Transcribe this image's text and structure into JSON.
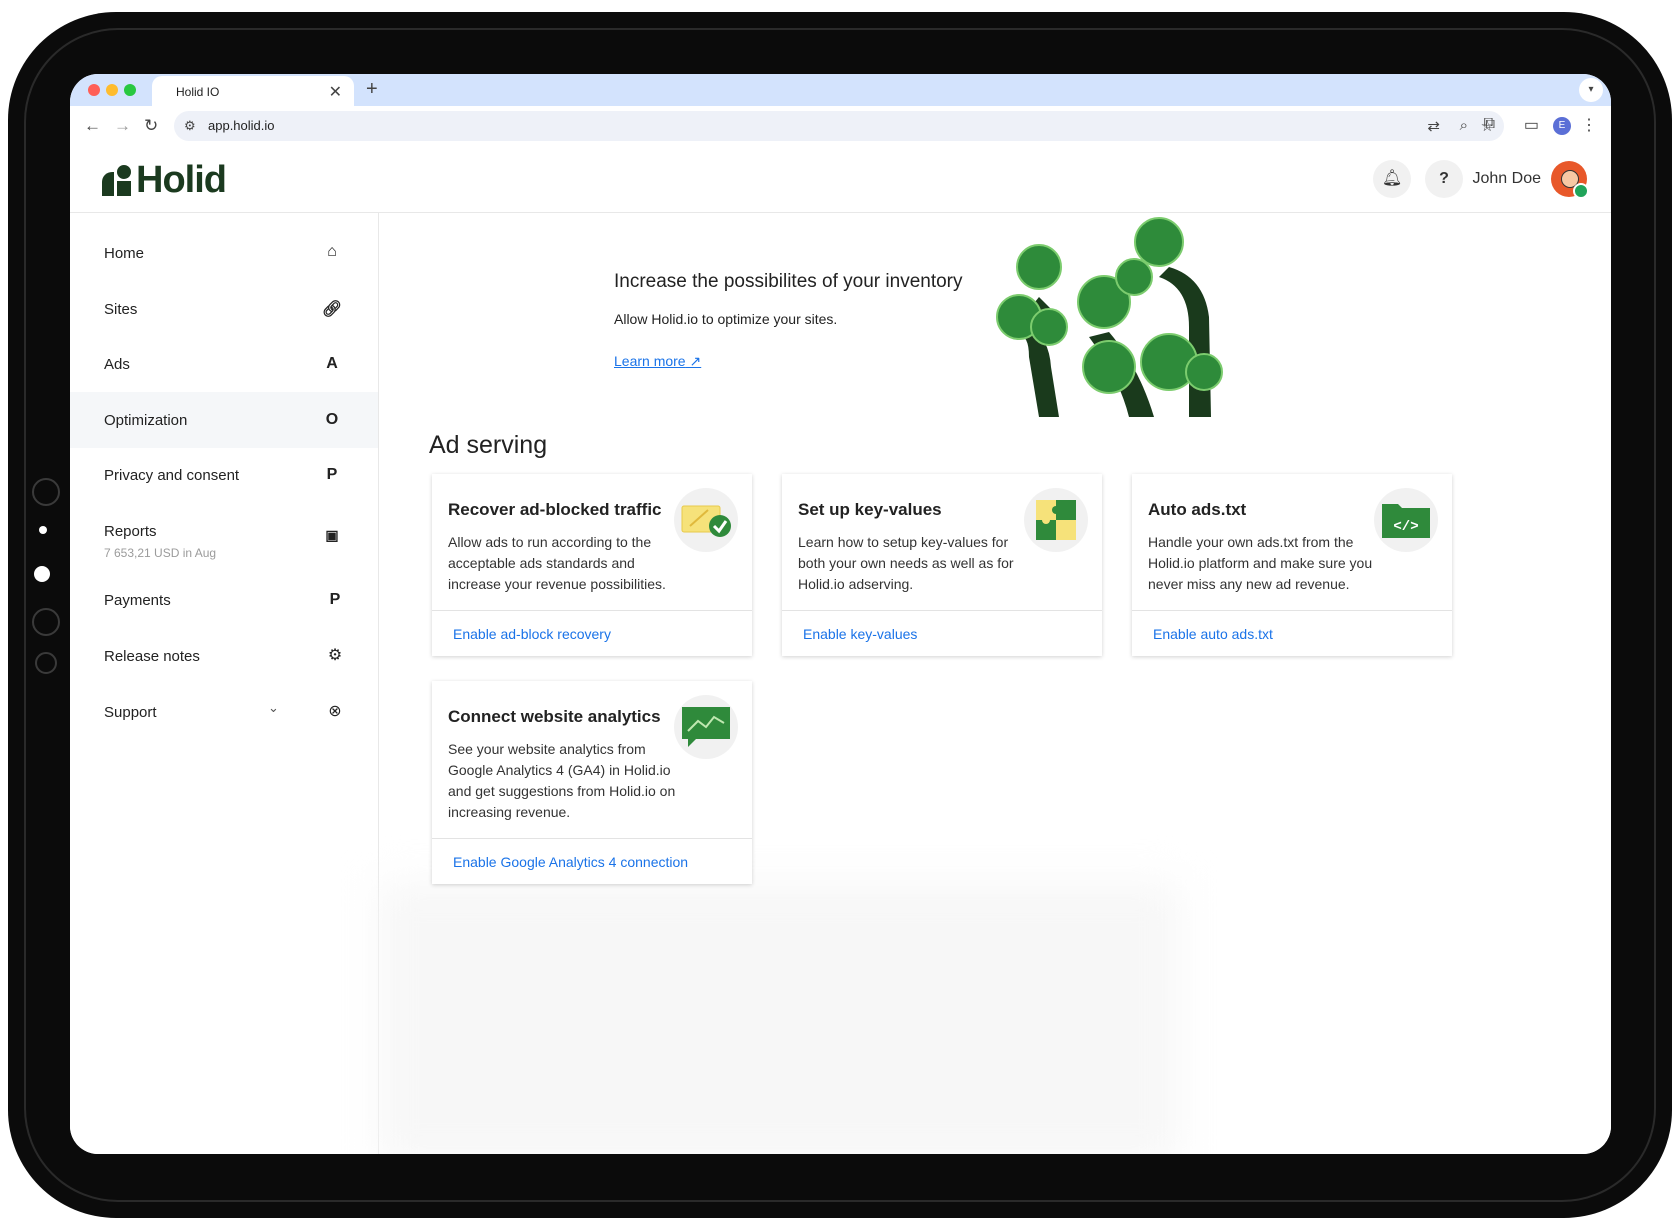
{
  "browser": {
    "tab_title": "Holid IO",
    "close_glyph": "✕",
    "new_tab_glyph": "+",
    "url": "app.holid.io",
    "profile_initial": "E"
  },
  "header": {
    "logo_text": "Holid",
    "user_name": "John Doe",
    "help_glyph": "?"
  },
  "sidebar": {
    "items": [
      {
        "label": "Home",
        "icon": "home-icon"
      },
      {
        "label": "Sites",
        "icon": "link-icon"
      },
      {
        "label": "Ads",
        "icon_text": "A"
      },
      {
        "label": "Optimization",
        "icon_text": "O",
        "active": true
      },
      {
        "label": "Privacy and consent",
        "icon_text": "P"
      },
      {
        "label": "Reports",
        "sub": "7 653,21 USD in Aug",
        "icon": "money-icon"
      },
      {
        "label": "Payments",
        "icon_text": "P"
      },
      {
        "label": "Release notes",
        "icon": "gear-icon"
      },
      {
        "label": "Support",
        "icon": "lifebuoy-icon"
      }
    ]
  },
  "hero": {
    "title": "Increase the possibilites of your inventory",
    "description": "Allow Holid.io to optimize your sites.",
    "link": "Learn more"
  },
  "section_title": "Ad serving",
  "cards": [
    {
      "title": "Recover ad-blocked traffic",
      "description": "Allow ads to run according to the acceptable ads standards and increase your revenue possibilities.",
      "link": "Enable ad-block recovery",
      "icon": "adblock-check-icon"
    },
    {
      "title": "Set up key-values",
      "description": "Learn how to setup key-values for both your own needs as well as for Holid.io adserving.",
      "link": "Enable key-values",
      "icon": "puzzle-icon"
    },
    {
      "title": "Auto ads.txt",
      "description": "Handle your own ads.txt from the Holid.io platform and make sure you never miss any new ad revenue.",
      "link": "Enable auto ads.txt",
      "icon": "code-folder-icon"
    },
    {
      "title": "Connect website analytics",
      "description": "See your website analytics from Google Analytics 4 (GA4) in Holid.io and get suggestions from Holid.io on increasing revenue.",
      "link": "Enable Google Analytics 4 connection",
      "icon": "analytics-chart-icon"
    }
  ],
  "colors": {
    "brand_green": "#1b3a1f",
    "link_blue": "#1a73e8",
    "tab_strip": "#d3e3fd",
    "avatar": "#e8582a"
  }
}
